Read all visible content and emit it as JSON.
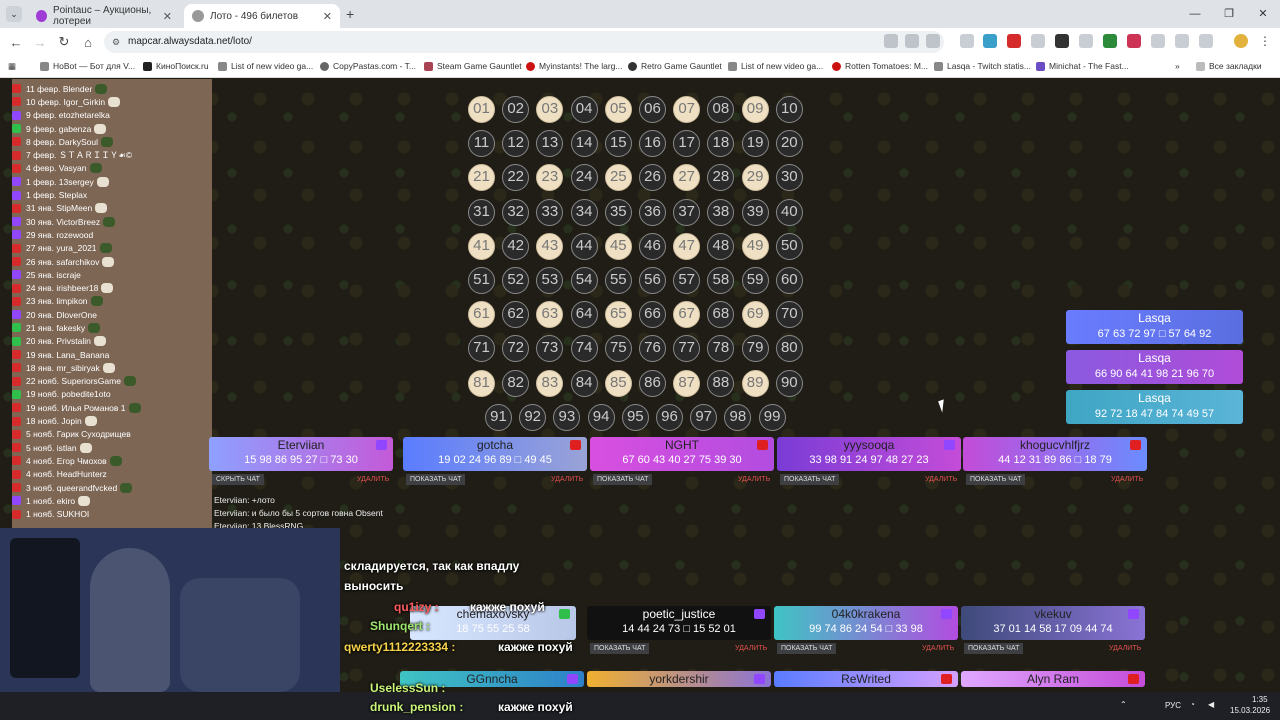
{
  "browser": {
    "tab1": "Pointauc – Аукционы, лотереи",
    "tab2": "Лото - 496 билетов",
    "url": "mapcar.alwaysdata.net/loto/",
    "bookmarks": [
      "НоBot — Бот для V...",
      "КиноПоиск.ru",
      "List of new video ga...",
      "CopyPastas.com - T...",
      "Steam Game Gauntlet",
      "Myinstants! The larg...",
      "Retro Game Gauntlet",
      "List of new video ga...",
      "Rotten Tomatoes: M...",
      "Lasqa - Twitch statis...",
      "Minichat - The Fast..."
    ],
    "all_bookmarks": "Все закладки"
  },
  "winners": [
    "11 февр. Blender",
    "10 февр. Igor_Girkin",
    "9 февр. etozhetarelka",
    "9 февр. gabenza",
    "8 февр. DarkySoul",
    "7 февр. ＳＴＡＲＩＩＹ☙©",
    "4 февр. Vasyan",
    "1 февр. 13sergey",
    "1 февр. Steplax",
    "31 янв. StipMeen",
    "30 янв. VictorBreez",
    "29 янв. rozewood",
    "27 янв. yura_2021",
    "26 янв. safarchikov",
    "25 янв. iscraje",
    "24 янв. irishbeer18",
    "23 янв. limpikon",
    "20 янв. DloverOne",
    "21 янв. fakesky",
    "20 янв. Privstalin",
    "19 янв. Lana_Banana",
    "18 янв. mr_sibiryak",
    "22 нояб. SuperiorsGame",
    "19 нояб. pobedite1oto",
    "19 нояб. Илья Романов 1",
    "18 нояб. Jopin",
    "5 нояб. Гарик Суходрищев",
    "5 нояб. istlan",
    "4 нояб. Егор Чмохов",
    "4 нояб. HeadHunterz",
    "3 нояб. queerandfvcked",
    "1 нояб. ekiro",
    "1 нояб. SUKHOI"
  ],
  "board_called": [
    1,
    3,
    5,
    7,
    9,
    21,
    23,
    25,
    27,
    29,
    41,
    43,
    45,
    47,
    49,
    61,
    63,
    65,
    67,
    69,
    81,
    83,
    85,
    87,
    89
  ],
  "cards": [
    {
      "name": "Eterviian",
      "nums": "15 98 86 95 27 □ 73 30",
      "btn": "СКРЫТЬ ЧАТ",
      "del": "УДАЛИТЬ"
    },
    {
      "name": "gotcha",
      "nums": "19 02 24 96 89 □ 49 45",
      "btn": "ПОКАЗАТЬ ЧАТ",
      "del": "УДАЛИТЬ"
    },
    {
      "name": "NGHT",
      "nums": "67 60 43 40 27 75 39 30",
      "btn": "ПОКАЗАТЬ ЧАТ",
      "del": "УДАЛИТЬ"
    },
    {
      "name": "yyysooqa",
      "nums": "33 98 91 24 97 48 27 23",
      "btn": "ПОКАЗАТЬ ЧАТ",
      "del": "УДАЛИТЬ"
    },
    {
      "name": "khogucvhlfjrz",
      "nums": "44 12 31 89 86 □ 18 79",
      "btn": "ПОКАЗАТЬ ЧАТ",
      "del": "УДАЛИТЬ"
    },
    {
      "name": "chemaxovsky",
      "nums": "18 75 55 25 58",
      "btn": "",
      "del": ""
    },
    {
      "name": "poetic_justice",
      "nums": "14 44 24 73 □ 15 52 01",
      "btn": "ПОКАЗАТЬ ЧАТ",
      "del": "УДАЛИТЬ"
    },
    {
      "name": "04k0krakena",
      "nums": "99 74 86 24 54 □ 33 98",
      "btn": "ПОКАЗАТЬ ЧАТ",
      "del": "УДАЛИТЬ"
    },
    {
      "name": "vkekuv",
      "nums": "37 01 14 58 17 09 44 74",
      "btn": "ПОКАЗАТЬ ЧАТ",
      "del": "УДАЛИТЬ"
    },
    {
      "name": "GGnncha",
      "nums": "",
      "btn": "",
      "del": ""
    },
    {
      "name": "yorkdershir",
      "nums": "",
      "btn": "",
      "del": ""
    },
    {
      "name": "ReWrited",
      "nums": "",
      "btn": "",
      "del": ""
    },
    {
      "name": "Alyn Ram",
      "nums": "",
      "btn": "",
      "del": ""
    }
  ],
  "right_cards": [
    {
      "name": "Lasqa",
      "nums": "67 63 72 97 □ 57 64 92"
    },
    {
      "name": "Lasqa",
      "nums": "66 90 64 41 98 21 96 70"
    },
    {
      "name": "Lasqa",
      "nums": "92 72 18 47 84 74 49 57"
    }
  ],
  "chat": [
    "Eterviian: +лото",
    "Eterviian: и было бы 5 сортов говна Obsent",
    "Eterviian: 13 BlessRNG"
  ],
  "overlay": {
    "line1": "складируется, так как впадлу",
    "line2": "выносить",
    "chat": [
      {
        "user": "qu1izy :",
        "text": "кажже похуй"
      },
      {
        "user": "Shunqert :",
        "text": "кажже похуй"
      },
      {
        "user": "qwerty1112223334 :",
        "text": "кажже похуй"
      },
      {
        "user": "UselessSun :",
        "text": ""
      },
      {
        "user": "drunk_pension :",
        "text": "кажже похуй"
      }
    ]
  },
  "taskbar": {
    "lang": "РУС",
    "time": "1:35",
    "date": "15.03.2026"
  }
}
